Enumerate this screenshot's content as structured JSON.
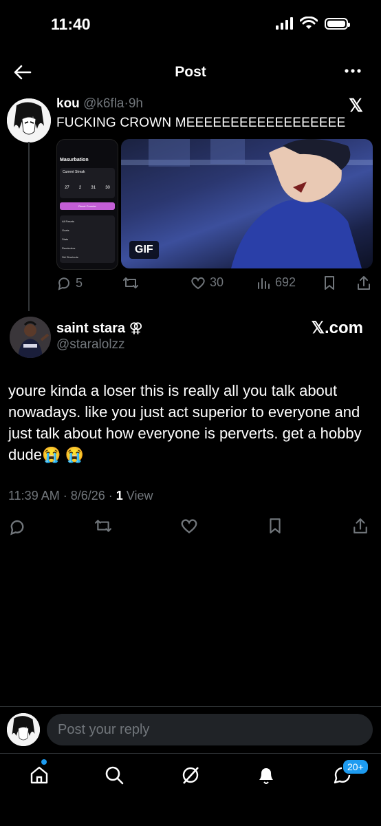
{
  "status": {
    "time": "11:40"
  },
  "header": {
    "title": "Post",
    "back_icon": "arrow-left-icon",
    "more_icon": "more-icon"
  },
  "quoted": {
    "name": "kou",
    "handle": "@k6fla",
    "time": "9h",
    "text": "FUCKING CROWN MEEEEEEEEEEEEEEEEEE",
    "brand": "𝕏",
    "gif_label": "GIF",
    "screenshot": {
      "title": "Masurbation",
      "card_title": "Current Streak",
      "stats": [
        "27",
        "2",
        "31",
        "30"
      ],
      "button": "Reset Counter",
      "list": [
        "All Resets",
        "Goals",
        "Stats",
        "Reminders",
        "Siri Shortcuts"
      ]
    },
    "stats": {
      "replies": "5",
      "likes": "30",
      "views": "692"
    }
  },
  "post": {
    "name": "saint stara",
    "name_symbol": "⚢",
    "handle": "@staralolzz",
    "brand": "𝕏.com",
    "text": "youre kinda a loser this is really all you talk about nowadays. like you just act superior to everyone and just talk about how everyone is perverts. get a hobby dude😭 😭",
    "time": "11:39 AM",
    "date": "8/6/26",
    "views_count": "1",
    "views_label": "View"
  },
  "reply": {
    "placeholder": "Post your reply"
  },
  "nav": {
    "notifications_badge": "20+"
  },
  "colors": {
    "accent": "#1d9bf0",
    "muted": "#71767b",
    "background": "#000000"
  }
}
